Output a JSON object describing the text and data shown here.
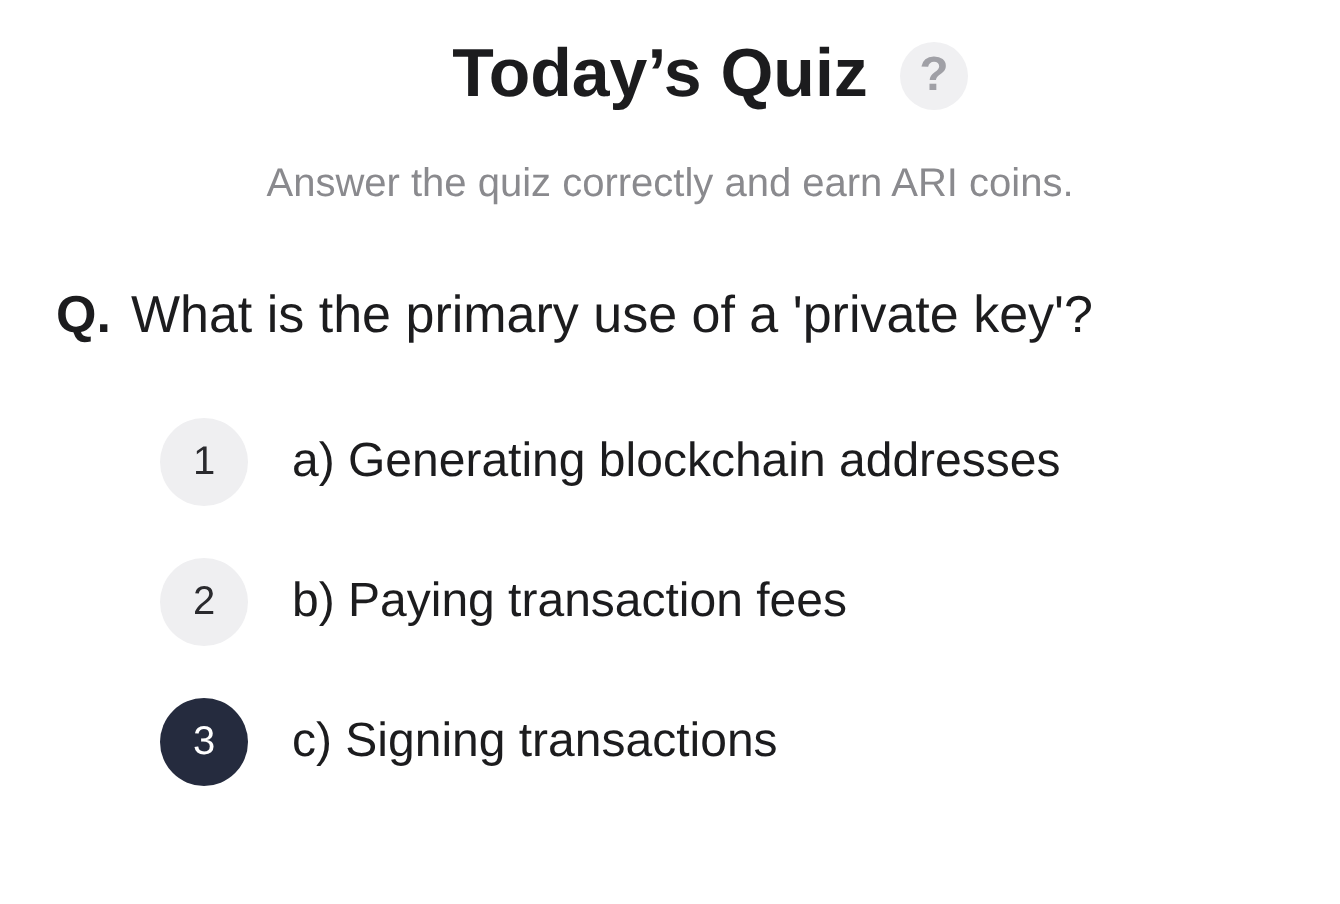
{
  "title": "Today’s Quiz",
  "help_icon": "?",
  "subtitle": "Answer the quiz correctly and earn ARI coins.",
  "question": {
    "prefix": "Q.",
    "text": "What is the primary use of a 'private key'?"
  },
  "options": [
    {
      "number": "1",
      "label": "a) Generating blockchain addresses",
      "selected": false
    },
    {
      "number": "2",
      "label": "b) Paying transaction fees",
      "selected": false
    },
    {
      "number": "3",
      "label": "c) Signing transactions",
      "selected": true
    }
  ]
}
